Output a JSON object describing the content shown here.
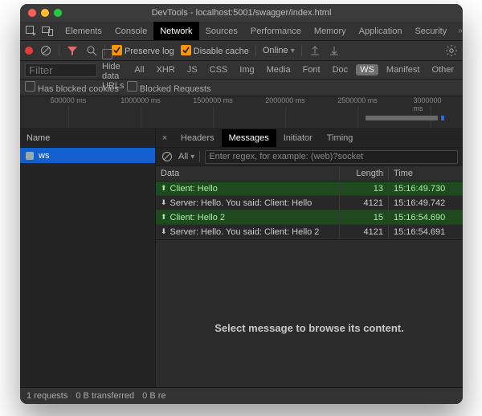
{
  "window": {
    "title": "DevTools - localhost:5001/swagger/index.html"
  },
  "panelTabs": [
    "Elements",
    "Console",
    "Network",
    "Sources",
    "Performance",
    "Memory",
    "Application",
    "Security"
  ],
  "panelActive": 2,
  "toolbar": {
    "preserve_log": "Preserve log",
    "disable_cache": "Disable cache",
    "throttling": "Online"
  },
  "filter": {
    "placeholder": "Filter",
    "hide_data_urls": "Hide data URLs",
    "types": [
      "All",
      "XHR",
      "JS",
      "CSS",
      "Img",
      "Media",
      "Font",
      "Doc",
      "WS",
      "Manifest",
      "Other"
    ],
    "active_type": "WS",
    "blocked_cookies": "Has blocked cookies",
    "blocked_requests": "Blocked Requests"
  },
  "overview": {
    "ticks": [
      "500000 ms",
      "1000000 ms",
      "1500000 ms",
      "2000000 ms",
      "2500000 ms",
      "3000000 ms"
    ]
  },
  "requestList": {
    "header": "Name",
    "items": [
      {
        "name": "ws"
      }
    ]
  },
  "detailTabs": [
    "Headers",
    "Messages",
    "Initiator",
    "Timing"
  ],
  "detailActive": 1,
  "messagesToolbar": {
    "filter_all": "All",
    "regex_placeholder": "Enter regex, for example: (web)?socket"
  },
  "messagesHeader": {
    "data": "Data",
    "length": "Length",
    "time": "Time"
  },
  "messages": [
    {
      "dir": "up",
      "data": "Client: Hello",
      "length": "13",
      "time": "15:16:49.730"
    },
    {
      "dir": "down",
      "data": "Server: Hello. You said: Client: Hello",
      "length": "4121",
      "time": "15:16:49.742"
    },
    {
      "dir": "up",
      "data": "Client: Hello 2",
      "length": "15",
      "time": "15:16:54.690"
    },
    {
      "dir": "down",
      "data": "Server: Hello. You said: Client: Hello 2",
      "length": "4121",
      "time": "15:16:54.691"
    }
  ],
  "placeholder": "Select message to browse its content.",
  "status": {
    "requests": "1 requests",
    "transferred": "0 B transferred",
    "resources": "0 B re"
  }
}
